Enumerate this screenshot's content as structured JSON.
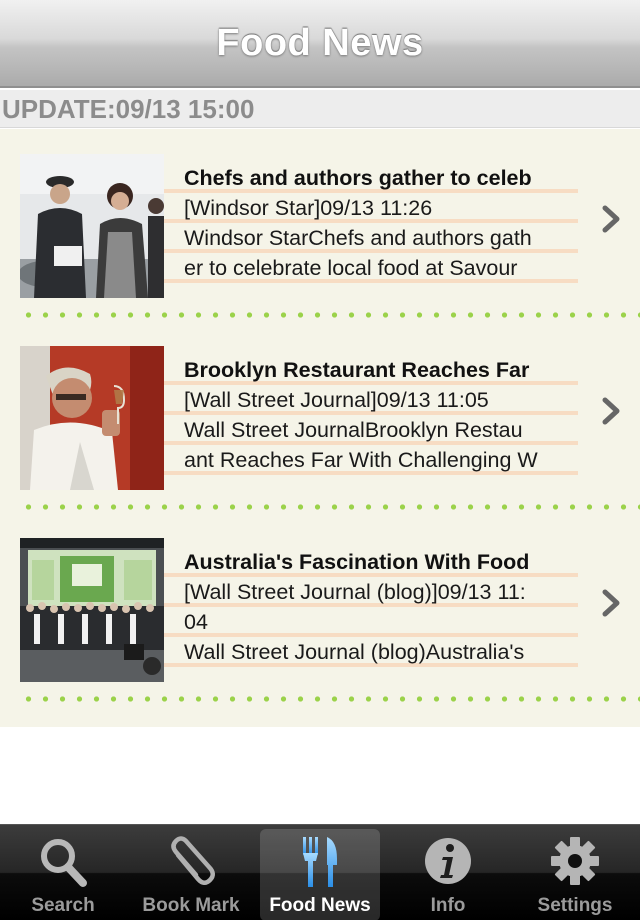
{
  "header": {
    "title": "Food News"
  },
  "update": {
    "text": "UPDATE:09/13 15:00"
  },
  "news": [
    {
      "lines": [
        "Chefs and authors gather to celeb",
        "[Windsor Star]09/13 11:26",
        "Windsor StarChefs and authors gath",
        "er to celebrate local food at Savour"
      ],
      "thumbnail": "photo-chef-with-woman"
    },
    {
      "lines": [
        "Brooklyn Restaurant Reaches Far",
        "[Wall Street Journal]09/13 11:05",
        "Wall Street JournalBrooklyn Restau",
        "ant Reaches Far With Challenging W"
      ],
      "thumbnail": "photo-man-with-wine-glass"
    },
    {
      "lines": [
        "Australia's Fascination With Food",
        "[Wall Street Journal (blog)]09/13 11:",
        "04",
        "Wall Street Journal (blog)Australia's"
      ],
      "thumbnail": "photo-crowd-on-stage"
    }
  ],
  "tabs": [
    {
      "label": "Search",
      "icon": "search-icon",
      "selected": false
    },
    {
      "label": "Book Mark",
      "icon": "paperclip-icon",
      "selected": false
    },
    {
      "label": "Food News",
      "icon": "fork-knife-icon",
      "selected": true
    },
    {
      "label": "Info",
      "icon": "info-icon",
      "selected": false
    },
    {
      "label": "Settings",
      "icon": "gear-icon",
      "selected": false
    }
  ],
  "colors": {
    "list_background": "#f5f4e8",
    "dot_green": "#9bd24a",
    "line_peach": "#f7dcc3",
    "tab_selected_blue": "#3aa6f2"
  }
}
